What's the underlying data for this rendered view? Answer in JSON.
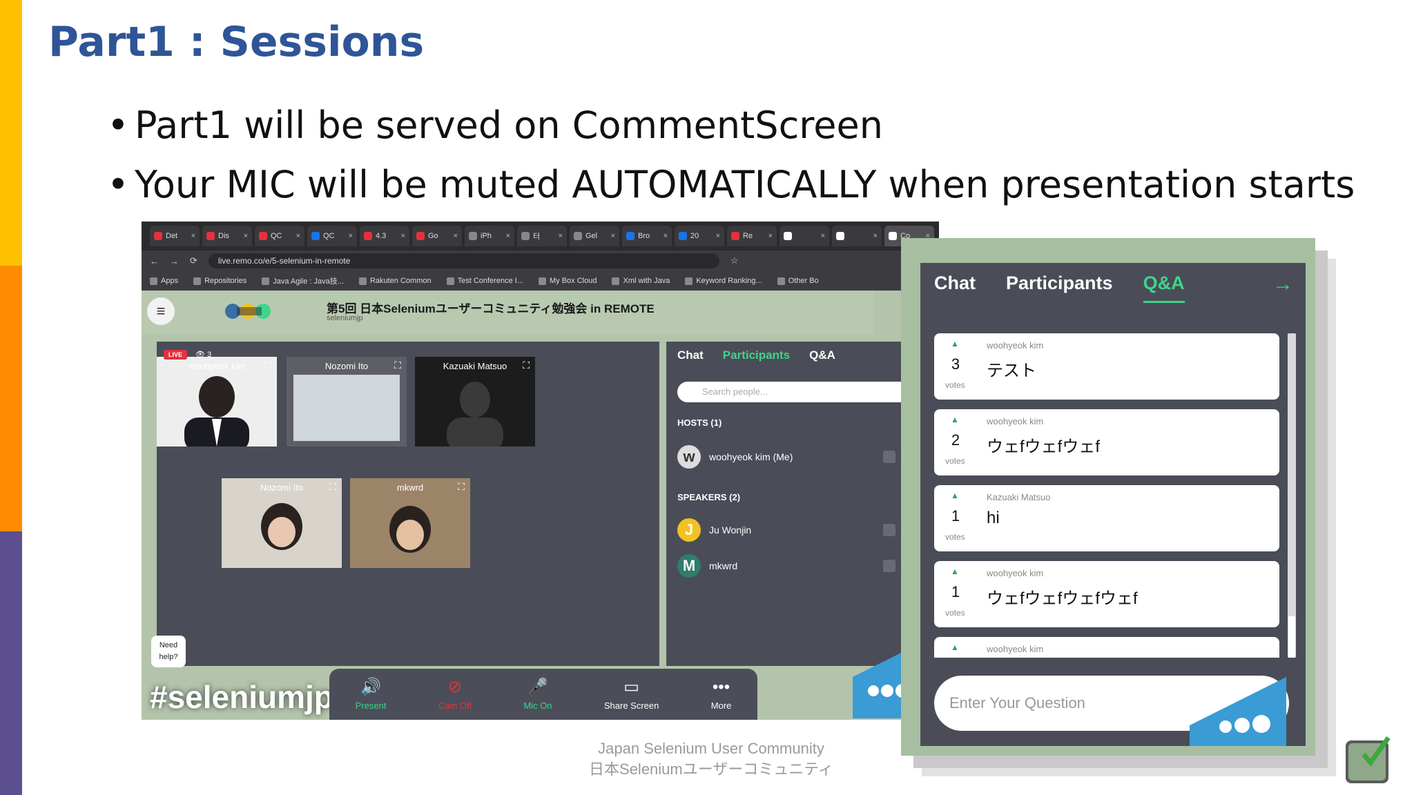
{
  "slide": {
    "title": "Part1 : Sessions",
    "bullets": [
      "Part1 will be served on CommentScreen",
      "Your MIC will be muted AUTOMATICALLY when presentation starts"
    ],
    "footer_en": "Japan Selenium User Community",
    "footer_jp": "日本Seleniumユーザーコミュニティ",
    "colors": {
      "title": "#2f5597",
      "bar_top": "#ffc000",
      "bar_mid": "#ff8c00",
      "bar_bottom": "#5b4f8f"
    }
  },
  "browser": {
    "tabs": [
      "Det",
      "Dis",
      "QC",
      "QC",
      "4.3",
      "Go",
      "iPh",
      "터",
      "Gel",
      "Bro",
      "20",
      "Re",
      "",
      "",
      "Co"
    ],
    "url": "live.remo.co/e/5-selenium-in-remote",
    "bookmarks": [
      "Apps",
      "Repositories",
      "Java Agile : Java技...",
      "Rakuten Common",
      "Test Conference I...",
      "My Box Cloud",
      "Xml with Java",
      "Keyword Ranking...",
      "Other Bo"
    ]
  },
  "remo": {
    "event_title": "第5回 日本Seleniumユーザーコミュニティ勉強会 in REMOTE",
    "event_sub": "seleniumjp",
    "live_badge": "LIVE",
    "viewers": "3",
    "videos": [
      {
        "name": "woohyeok kim"
      },
      {
        "name": "Nozomi Ito"
      },
      {
        "name": "Kazuaki Matsuo"
      },
      {
        "name": "Nozomi Ito"
      },
      {
        "name": "mkwrd"
      }
    ],
    "panel": {
      "tabs": [
        "Chat",
        "Participants",
        "Q&A"
      ],
      "active_tab": "Participants",
      "search_placeholder": "Search people...",
      "hosts_header": "HOSTS (1)",
      "host": {
        "name": "woohyeok kim (Me)"
      },
      "speakers_header": "SPEAKERS (2)",
      "speakers": [
        {
          "initial": "J",
          "name": "Ju Wonjin",
          "color": "#f2c122"
        },
        {
          "initial": "M",
          "name": "mkwrd",
          "color": "#2f7d6d"
        }
      ]
    },
    "controls": [
      {
        "label": "Present",
        "icon": "present-icon",
        "color": "#3dd58a"
      },
      {
        "label": "Cam Off",
        "icon": "camera-off-icon",
        "color": "#e6313c"
      },
      {
        "label": "Mic On",
        "icon": "mic-icon",
        "color": "#3dd58a"
      },
      {
        "label": "Share Screen",
        "icon": "share-screen-icon",
        "color": "#ffffff"
      },
      {
        "label": "More",
        "icon": "more-icon",
        "color": "#ffffff"
      }
    ],
    "need_help": [
      "Need",
      "help?"
    ],
    "hashtag": "#seleniumjp"
  },
  "qa": {
    "tabs": [
      "Chat",
      "Participants",
      "Q&A"
    ],
    "active_tab": "Q&A",
    "questions": [
      {
        "votes": "3",
        "votes_label": "votes",
        "author": "woohyeok kim",
        "text": "テスト"
      },
      {
        "votes": "2",
        "votes_label": "votes",
        "author": "woohyeok kim",
        "text": "ウェfウェfウェf"
      },
      {
        "votes": "1",
        "votes_label": "votes",
        "author": "Kazuaki Matsuo",
        "text": "hi"
      },
      {
        "votes": "1",
        "votes_label": "votes",
        "author": "woohyeok kim",
        "text": "ウェfウェfウェfウェf"
      },
      {
        "votes": "",
        "votes_label": "",
        "author": "woohyeok kim",
        "text": ""
      }
    ],
    "input_placeholder": "Enter Your Question"
  }
}
